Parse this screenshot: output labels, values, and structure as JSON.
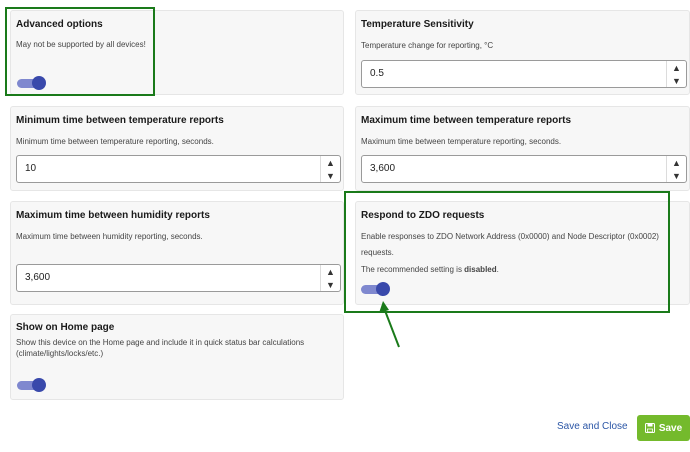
{
  "cards": {
    "advanced": {
      "title": "Advanced options",
      "desc": "May not be supported by all devices!"
    },
    "temp_sensitivity": {
      "title": "Temperature Sensitivity",
      "desc": "Temperature change for reporting, °C",
      "value": "0.5"
    },
    "min_temp": {
      "title": "Minimum time between temperature reports",
      "desc": "Minimum time between temperature reporting, seconds.",
      "value": "10"
    },
    "max_temp": {
      "title": "Maximum time between temperature reports",
      "desc": "Maximum time between temperature reporting, seconds.",
      "value": "3,600"
    },
    "max_humidity": {
      "title": "Maximum time between humidity reports",
      "desc": "Maximum time between humidity reporting, seconds.",
      "value": "3,600"
    },
    "zdo": {
      "title": "Respond to ZDO requests",
      "desc_line1": "Enable responses to ZDO Network Address (0x0000) and Node Descriptor (0x0002)",
      "desc_line2": "requests.",
      "recommended_prefix": "The recommended setting is ",
      "recommended_value": "disabled",
      "recommended_suffix": "."
    },
    "home": {
      "title": "Show on Home page",
      "desc_line1": "Show this device on the Home page and include it in quick status bar calculations",
      "desc_line2": "(climate/lights/locks/etc.)"
    }
  },
  "stepper": {
    "up": "▲",
    "down": "▼"
  },
  "footer": {
    "save_close_label": "Save and Close",
    "save_label": "Save",
    "save_icon": "floppy-disk-icon"
  },
  "colors": {
    "toggle_on": "#3949ab",
    "toggle_track": "#7f88cf",
    "highlight": "#1a7a1a",
    "save_bg": "#74ba2c",
    "link": "#2b56a6"
  }
}
